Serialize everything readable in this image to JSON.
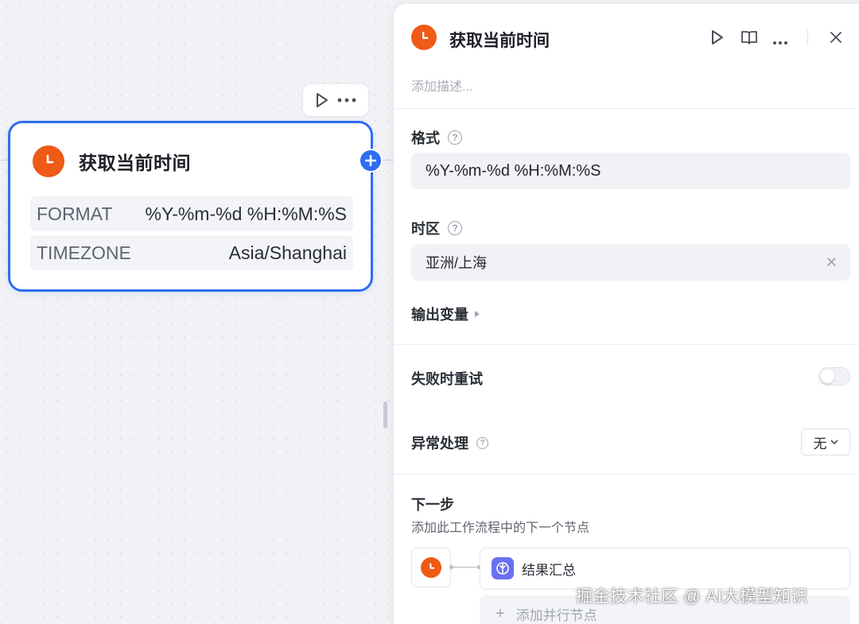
{
  "canvas": {
    "node": {
      "title": "获取当前时间",
      "rows": [
        {
          "key": "FORMAT",
          "value": "%Y-%m-%d %H:%M:%S"
        },
        {
          "key": "TIMEZONE",
          "value": "Asia/Shanghai"
        }
      ]
    }
  },
  "panel": {
    "title": "获取当前时间",
    "description_placeholder": "添加描述...",
    "format": {
      "label": "格式",
      "value": "%Y-%m-%d %H:%M:%S"
    },
    "timezone": {
      "label": "时区",
      "value": "亚洲/上海"
    },
    "output_vars": {
      "label": "输出变量"
    },
    "retry": {
      "label": "失败时重试",
      "enabled": false
    },
    "error_handling": {
      "label": "异常处理",
      "value": "无"
    },
    "next_step": {
      "title": "下一步",
      "subtitle": "添加此工作流程中的下一个节点",
      "next_node": "结果汇总",
      "add_parallel": "添加并行节点"
    }
  },
  "watermark": "掘金技术社区 @ AI大模型知识",
  "colors": {
    "accent": "#2e6cf2",
    "node_icon": "#ef5a16",
    "aggregator_icon": "#6871f1"
  }
}
